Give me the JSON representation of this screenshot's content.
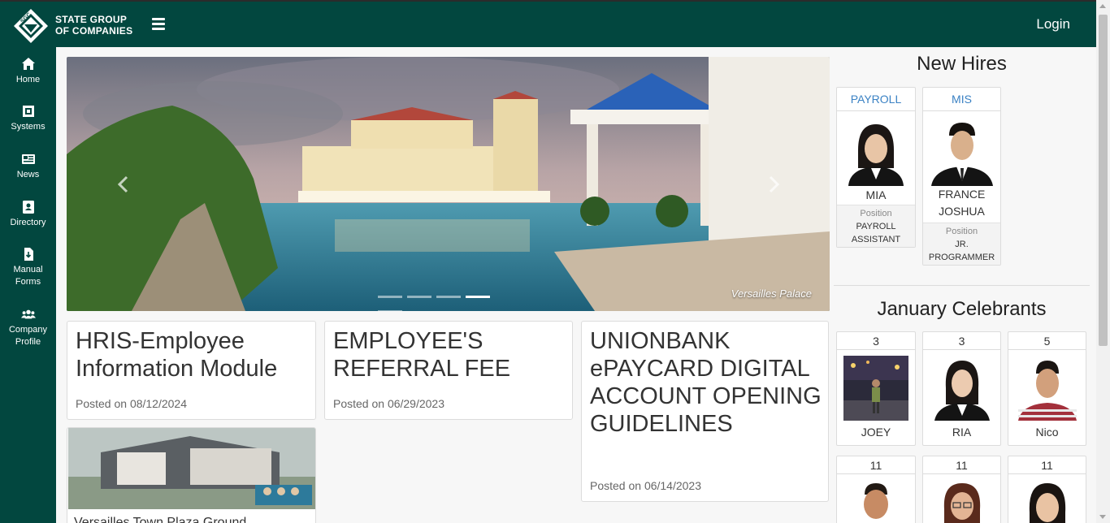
{
  "header": {
    "brand_line1": "STATE GROUP",
    "brand_line2": "OF COMPANIES",
    "login_label": "Login",
    "accent": "#02473f"
  },
  "sidebar": {
    "items": [
      {
        "label": "Home",
        "icon": "home-icon"
      },
      {
        "label": "Systems",
        "icon": "systems-icon"
      },
      {
        "label": "News",
        "icon": "newspaper-icon"
      },
      {
        "label": "Directory",
        "icon": "address-book-icon"
      },
      {
        "label_line1": "Manual",
        "label_line2": "Forms",
        "icon": "file-download-icon"
      },
      {
        "label_line1": "Company",
        "label_line2": "Profile",
        "icon": "users-icon"
      }
    ]
  },
  "carousel": {
    "caption": "Versailles Palace",
    "slide_count": 5,
    "active_index": 3
  },
  "news": [
    {
      "title": "HRIS-Employee Information Module",
      "date": "Posted on 08/12/2024"
    },
    {
      "title": "EMPLOYEE'S REFERRAL FEE",
      "date": "Posted on 06/29/2023"
    },
    {
      "title": "UNIONBANK ePAYCARD DIGITAL ACCOUNT OPENING GUIDELINES",
      "date": "Posted on 06/14/2023"
    },
    {
      "title": "Versailles Town Plaza Ground ..."
    }
  ],
  "new_hires": {
    "title": "New Hires",
    "position_label": "Position",
    "items": [
      {
        "dept": "PAYROLL",
        "name": "MIA",
        "position_line1": "PAYROLL",
        "position_line2": "ASSISTANT"
      },
      {
        "dept": "MIS",
        "name_line1": "FRANCE",
        "name_line2": "JOSHUA",
        "position_line1": "JR.",
        "position_line2": "PROGRAMMER"
      }
    ]
  },
  "celebrants": {
    "title": "January Celebrants",
    "items": [
      {
        "day": "3",
        "name": "JOEY"
      },
      {
        "day": "3",
        "name": "RIA"
      },
      {
        "day": "5",
        "name": "Nico"
      },
      {
        "day": "11"
      },
      {
        "day": "11"
      },
      {
        "day": "11"
      }
    ]
  }
}
